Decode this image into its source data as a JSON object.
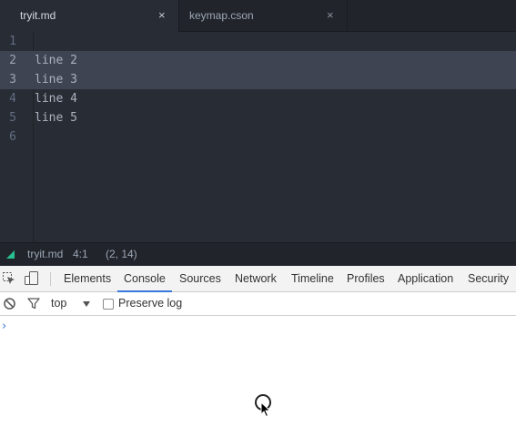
{
  "editor": {
    "tabs": [
      {
        "label": "tryit.md",
        "close": "×",
        "active": true
      },
      {
        "label": "keymap.cson",
        "close": "×",
        "active": false
      }
    ],
    "lines": [
      {
        "num": "1",
        "text": "",
        "selected": false
      },
      {
        "num": "2",
        "text": "line 2",
        "selected": true
      },
      {
        "num": "3",
        "text": "line 3",
        "selected": true
      },
      {
        "num": "4",
        "text": "line 4",
        "selected": false
      },
      {
        "num": "5",
        "text": "line 5",
        "selected": false
      },
      {
        "num": "6",
        "text": "",
        "selected": false
      }
    ]
  },
  "status_bar": {
    "file": "tryit.md",
    "cursor_position": "4:1",
    "selection_info": "(2, 14)"
  },
  "devtools": {
    "tabs": [
      "Elements",
      "Console",
      "Sources",
      "Network",
      "Timeline",
      "Profiles",
      "Application",
      "Security"
    ],
    "active_tab": "Console",
    "context": "top",
    "preserve_log_label": "Preserve log",
    "preserve_log_checked": false,
    "prompt_symbol": "›"
  },
  "colors": {
    "editor_bg": "#282c34",
    "selection": "#3e4451",
    "accent": "#3879d9",
    "status_icon": "#27c190"
  },
  "icons": [
    "inspect-element-icon",
    "device-toolbar-icon",
    "clear-console-icon",
    "filter-icon",
    "dropdown-caret-icon",
    "mouse-cursor-icon"
  ]
}
